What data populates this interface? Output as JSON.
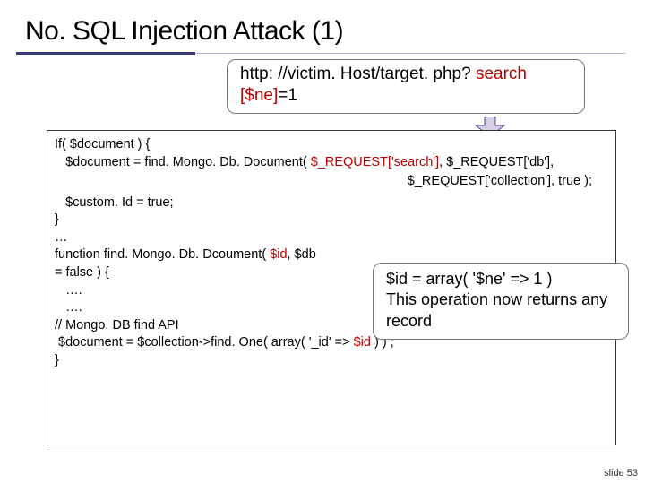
{
  "title": "No. SQL Injection Attack (1)",
  "url_callout": {
    "prefix": "http: //victim. Host/target. php? ",
    "search": "search",
    "line2_ne": "[$ne]",
    "line2_rest": "=1"
  },
  "code": {
    "l1": "If( $document ) {",
    "l2_a": "   $document = find. Mongo. Db. Document( ",
    "l2_b": "$_REQUEST['search']",
    "l2_c": ", $_REQUEST['db'],",
    "l3": "$_REQUEST['collection'], true );",
    "l4": "   $custom. Id = true;",
    "l5": "}",
    "l6": "…",
    "l7_a": "function find. Mongo. Db. Dcoument( ",
    "l7_b": "$id",
    "l7_c": ", $db",
    "l7_d": "= false ) {",
    "l8": "   ….",
    "l9": "   ….",
    "l10": "// Mongo. DB find API",
    "l11_a": " $document = $collection->find. One( array( '_id' => ",
    "l11_b": "$id",
    "l11_c": " ) ) ;",
    "l12": "}"
  },
  "explain": {
    "l1": "$id = array( '$ne' => 1 )",
    "l2": "This operation now returns any record"
  },
  "slide_num": "slide 53"
}
